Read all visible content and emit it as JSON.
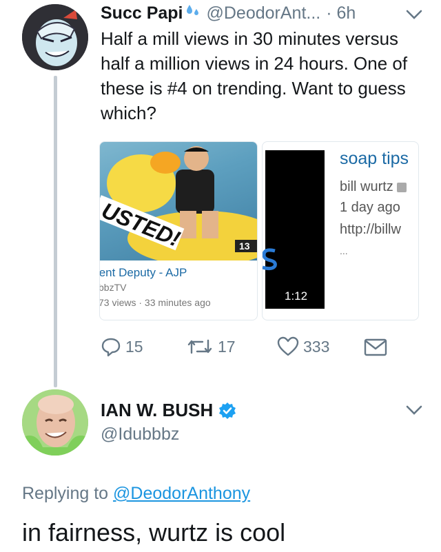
{
  "tweet1": {
    "name": "Succ Papi",
    "name_emoji": "sweat-droplets-icon",
    "handle": "@DeodorAnt...",
    "time": "· 6h",
    "text": "Half a mill views in 30 minutes versus half a million views in 24 hours. One of these is #4 on trending. Want to guess which?",
    "card1": {
      "thumb_overlay_text": "USTED!",
      "thumb_badge": "13",
      "title": "tent Deputy - AJP",
      "channel": "bbzTV",
      "views": "73 views · 33 minutes ago"
    },
    "card2": {
      "title": "soap tips",
      "channel": "bill wurtz",
      "date": "1 day ago",
      "url": "http://billw",
      "ellipsis": "...",
      "duration": "1:12"
    },
    "actions": {
      "replies": "15",
      "retweets": "17",
      "likes": "333"
    }
  },
  "tweet2": {
    "name": "IAN W. BUSH",
    "verified": true,
    "handle": "@Idubbbz",
    "replying_prefix": "Replying to",
    "replying_to": "@DeodorAnthony",
    "text": "in fairness, wurtz is cool"
  },
  "colors": {
    "link": "#1b95e0",
    "secondary_text": "#657786",
    "verified": "#1da1f2",
    "thread_line": "#c4ccd3"
  }
}
